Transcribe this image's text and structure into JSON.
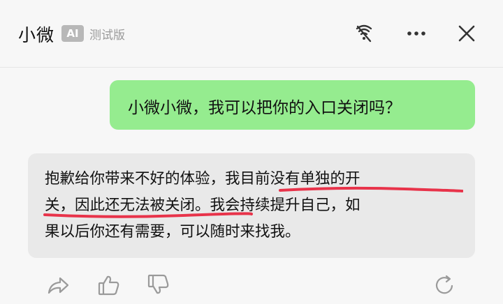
{
  "header": {
    "title": "小微",
    "badge": "AI",
    "subtitle": "测试版",
    "icons": [
      "mute-icon",
      "more-icon",
      "close-icon"
    ]
  },
  "chat": {
    "user_message": "小微小微，我可以把你的入口关闭吗？",
    "bot_lines": [
      "抱歉给你带来不好的体验，我目前没有单独的开",
      "关，因此还无法被关闭。我会持续提升自己，如",
      "果以后你还有需要，可以随时来找我。"
    ],
    "actions": [
      "share-icon",
      "thumbs-up-icon",
      "thumbs-down-icon",
      "refresh-icon"
    ]
  },
  "colors": {
    "user_bubble": "#95ec8f",
    "bot_bubble": "#e9e9e9",
    "highlight_underline": "#e8334a",
    "icon_gray": "#9a9a9a"
  }
}
